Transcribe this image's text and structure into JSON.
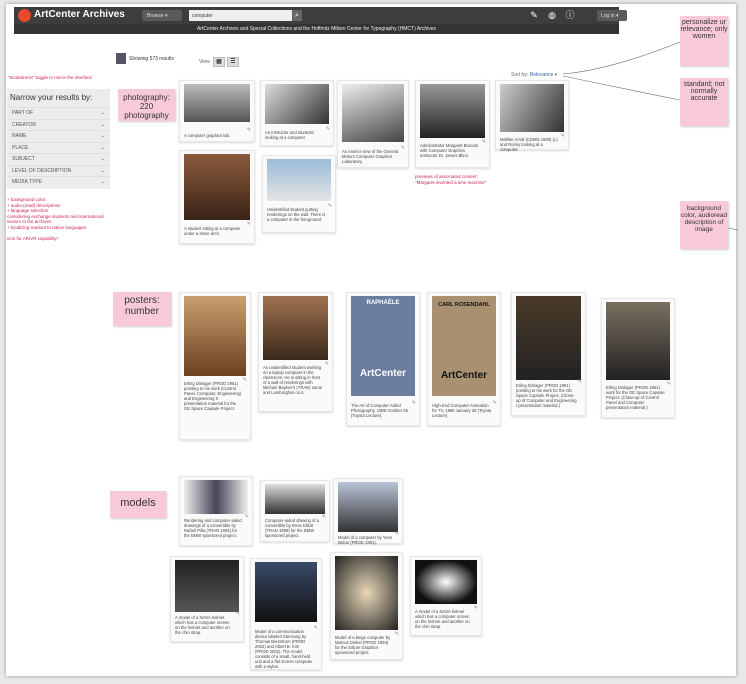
{
  "header": {
    "logo": "ArtCenter Archives",
    "browse_label": "Browse",
    "search_value": "computer",
    "login_label": "Log in",
    "subtitle": "ArtCenter Archives and Special Collections and the Hoffmitz Milken Center for Typography (HMCT) Archives"
  },
  "results": {
    "showing": "Showing 573 results",
    "view_label": "View",
    "sort_label": "Sort by:",
    "sort_value": "Relevance"
  },
  "sidebar": {
    "toggle_note": "\"tundedness\" toggle to mirror the interface",
    "title": "Narrow your results by:",
    "facets": [
      "PART OF",
      "CREATOR",
      "NAME",
      "PLACE",
      "SUBJECT",
      "LEVEL OF DESCRIPTION",
      "MEDIA TYPE"
    ],
    "notes": [
      "+ background color",
      "+ audio (read) descriptions",
      "+ language selection",
      "considering exchange students and international visitors to the archives",
      "+ localizing readout to native languages",
      "icon for AR/VR capability!"
    ]
  },
  "stickies": {
    "photography": "photography: 220 photography",
    "posters": "posters: number",
    "models": "models",
    "personalize": "personalize ur relevance; only women",
    "standard": "standard; not normally accurate",
    "background": "background color, audioread description of image"
  },
  "preview_note": [
    "previews of associated content:",
    "\"Margaret invented a time machine\""
  ],
  "cards": [
    {
      "caption": "A computer graphics lab."
    },
    {
      "caption": "An instructor and students looking at a computer."
    },
    {
      "caption": "An interior view of the General Motors Computer Graphics Laboratory."
    },
    {
      "caption": "Administrator Margaret Brucato with Computer Graphics Instructor Dr. James Blinn."
    },
    {
      "caption": "Mahlke Arndt (CDMN 1980) (L) and Ronny looking at a computer."
    },
    {
      "caption": "A student sitting at a computer under a stone arch."
    },
    {
      "caption": "Unidentified student putting renderings on the wall. There is a computer in the foreground."
    },
    {
      "caption": "Erling Dinlager (PROD 1961) pointing to his work (Control Panel, Computer, Engineering) and Engineering II presentation material for the GE Space Capsule Project."
    },
    {
      "caption": "An unidentified student working on a laptop computer in the classroom. He is sitting in front of a wall of renderings with Michael Baykov's (TRAN) name and Lamborghini on it."
    },
    {
      "caption": "The Art of Computer-Aided Photography, 1988 October 05 (Toyota Lecture)."
    },
    {
      "caption": "High-End Computer Animation for TV, 1988 January 28 (Toyota Lecture)."
    },
    {
      "caption": "Erling Dinlager (PROD 1961) pointing to his work for the GE Space Capsule Project. (Close-up of Computer and Engineering I presentation material.)"
    },
    {
      "caption": "Erling Dinlager (PROD 1961) work for the GE Space Capsule Project. (Close-up of Control Panel and Computer presentation material.)"
    },
    {
      "caption": "Rendering and computer-aided drawings of a convertible by Rafael Pilla (TRAN 1994) for the BMW sponsored project."
    },
    {
      "caption": "Computer-aided drawing of a convertible by Ernie Elliott (TRAN 1989) for the BMW sponsored project."
    },
    {
      "caption": "Model of a computer by Yves Behar (PROD 1991)."
    },
    {
      "caption": "A model of a NASA helmet which has a computer screen on the helmet and another on the chin strap."
    },
    {
      "caption": "Model of a communication device labeled Samsung by Thomas Bernstrom (PROD 2002) and Albert B. Kim (PROD 2002). The model consists of a small, hand-held unit and a flat screen computer with a stylus."
    },
    {
      "caption": "Model of a beige computer by Marcus Diebel (PROD 1994) for the Silicon Graphics sponsored project."
    },
    {
      "caption": "A model of a NASA helmet which has a computer screen on the helmet and another on the chin strap."
    }
  ],
  "poster_text": {
    "raphaele": "RAPHAËLE",
    "artcenter": "ArtCenter",
    "carl": "CARL ROSENDAHL"
  }
}
